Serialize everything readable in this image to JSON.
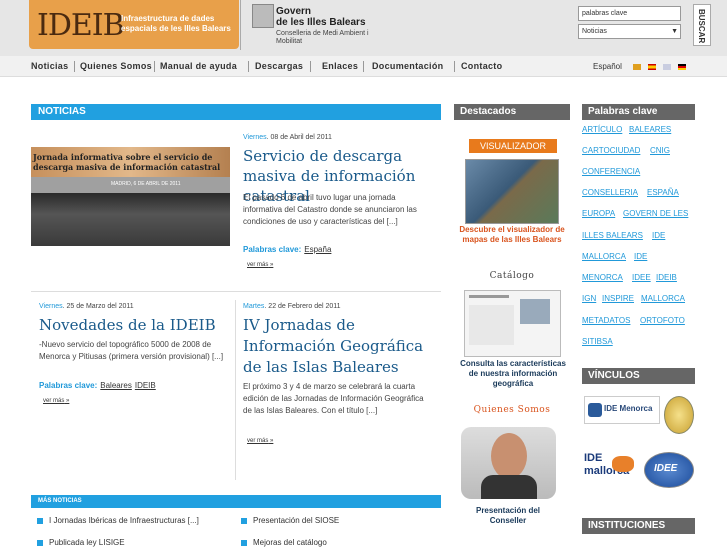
{
  "header": {
    "logo_text": "IDEIB",
    "logo_subtitle": "Infraestructura de dades espacials de les Illes Balears",
    "govern_line1": "Govern",
    "govern_line2": "de les Illes Balears",
    "govern_line3": "Conselleria de Medi Ambient i Mobilitat",
    "search_value": "palabras clave",
    "search_select_value": "Noticias",
    "search_button_label": "BUSCAR"
  },
  "nav": {
    "items": [
      "Noticias",
      "Quienes Somos",
      "Manual de ayuda",
      "Descargas",
      "Enlaces",
      "Documentación",
      "Contacto"
    ],
    "language": "Español"
  },
  "noticias": {
    "heading": "NOTICIAS",
    "featured": {
      "image_caption_line1": "Jornada informativa sobre el servicio de",
      "image_caption_line2": "descarga masiva de información catastral",
      "image_caption_date": "MADRID, 6 DE ABRIL DE 2011",
      "day": "Viernes",
      "date": ". 08 de Abril del 2011",
      "title": "Servicio de descarga masiva de información catastral",
      "body": "El pasado 6 de abril tuvo lugar una jornada informativa del Catastro donde se anunciaron las condiciones de uso y características del [...]",
      "keywords_label": "Palabras clave:",
      "keywords": [
        "España"
      ],
      "more": "ver más"
    },
    "left": {
      "day": "Viernes",
      "date": ". 25 de Marzo del 2011",
      "title": "Novedades de la IDEIB",
      "body": "-Nuevo servicio del topográfico 5000 de 2008 de Menorca y Pitiusas (primera versión provisional) [...]",
      "keywords_label": "Palabras clave:",
      "keywords": [
        "Baleares",
        "IDEIB"
      ],
      "more": "ver más"
    },
    "right": {
      "day": "Martes",
      "date": ". 22 de Febrero del 2011",
      "title": "IV Jornadas de Información Geográfica de las Islas Baleares",
      "body": "El próximo 3 y 4 de marzo se celebrará la cuarta edición de las Jornadas de Información Geográfica de las Islas Baleares. Con el título [...]",
      "more": "ver más"
    },
    "more_news": {
      "heading": "MÁS NOTICIAS",
      "items_left": [
        "I Jornadas Ibéricas de Infraestructuras [...]",
        "Publicada ley LISIGE"
      ],
      "items_right": [
        "Presentación del SIOSE",
        "Mejoras del catálogo"
      ]
    }
  },
  "destacados": {
    "heading": "Destacados",
    "visualizador_label": "VISUALIZADOR",
    "visualizador_caption": "Descubre el visualizador de mapas de las Illes Balears",
    "catalogo_label": "Catálogo",
    "catalogo_caption": "Consulta las características de nuestra información geográfica",
    "quienes_label": "Quienes Somos",
    "presentacion_caption": "Presentación del Conseller"
  },
  "palabras_clave": {
    "heading": "Palabras clave",
    "items": [
      "ARTÍCULO",
      "BALEARES",
      "CARTOCIUDAD",
      "CNIG",
      "CONFERENCIA",
      "CONSELLERIA",
      "ESPAÑA",
      "EUROPA",
      "GOVERN DE LES",
      "ILLES BALEARS",
      "IDE",
      "MALLORCA",
      "IDE",
      "MENORCA",
      "IDEE",
      "IDEIB",
      "IGN",
      "INSPIRE",
      "MALLORCA",
      "METADATOS",
      "ORTOFOTO",
      "SITIBSA"
    ]
  },
  "vinculos": {
    "heading": "VÍNCULOS",
    "ide_menorca": "IDE Menorca",
    "ide_mallorca": "IDE mallorca",
    "idee": "IDEE"
  },
  "instituciones": {
    "heading": "INSTITUCIONES"
  },
  "colors": {
    "accent_blue": "#21a0e0",
    "logo_orange": "#e8a04a",
    "title_blue": "#1a5a8a",
    "orange_text": "#d9541e"
  }
}
